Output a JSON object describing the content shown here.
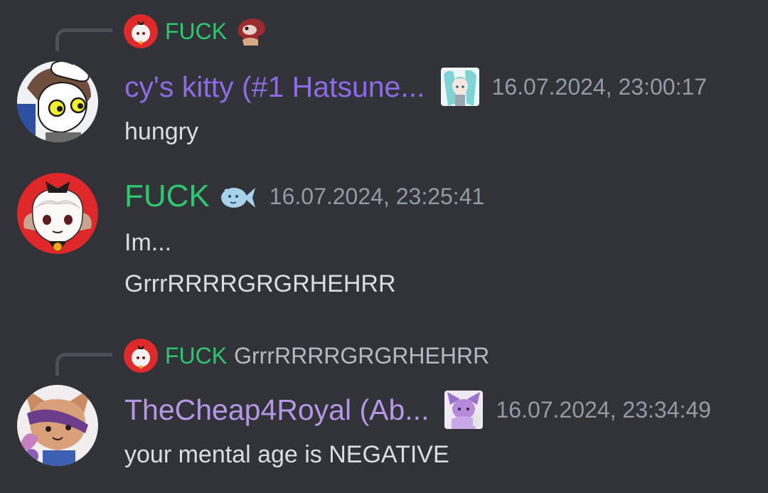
{
  "colors": {
    "background": "#313338",
    "text": "#dbdee1",
    "muted": "#949ba4",
    "green_role": "#2dc770",
    "purple_role": "#8d6be8",
    "lavender_role": "#b697e6"
  },
  "messages": [
    {
      "reply": {
        "author": "FUCK",
        "text": "",
        "avatar_icon": "red-avatar-icon",
        "emoji_icon": "red-creature-emoji-icon"
      },
      "author": "cy's kitty (#1 Hatsune...",
      "badge_icon": "hatsune-miku-badge-icon",
      "timestamp": "16.07.2024, 23:00:17",
      "lines": [
        "hungry"
      ],
      "avatar_icon": "cartoon-boy-avatar-icon"
    },
    {
      "author": "FUCK",
      "badge_icon": "blue-fish-badge-icon",
      "timestamp": "16.07.2024, 23:25:41",
      "lines": [
        "Im...",
        "GrrrRRRRGRGRHEHRR"
      ],
      "avatar_icon": "red-avatar-icon"
    },
    {
      "reply": {
        "author": "FUCK",
        "text": "GrrrRRRRGRGRHEHRR",
        "avatar_icon": "red-avatar-icon"
      },
      "author": "TheCheap4Royal (Ab...",
      "badge_icon": "purple-character-badge-icon",
      "timestamp": "16.07.2024, 23:34:49",
      "lines": [
        "your mental age is NEGATIVE"
      ],
      "avatar_icon": "purple-cat-avatar-icon"
    }
  ]
}
